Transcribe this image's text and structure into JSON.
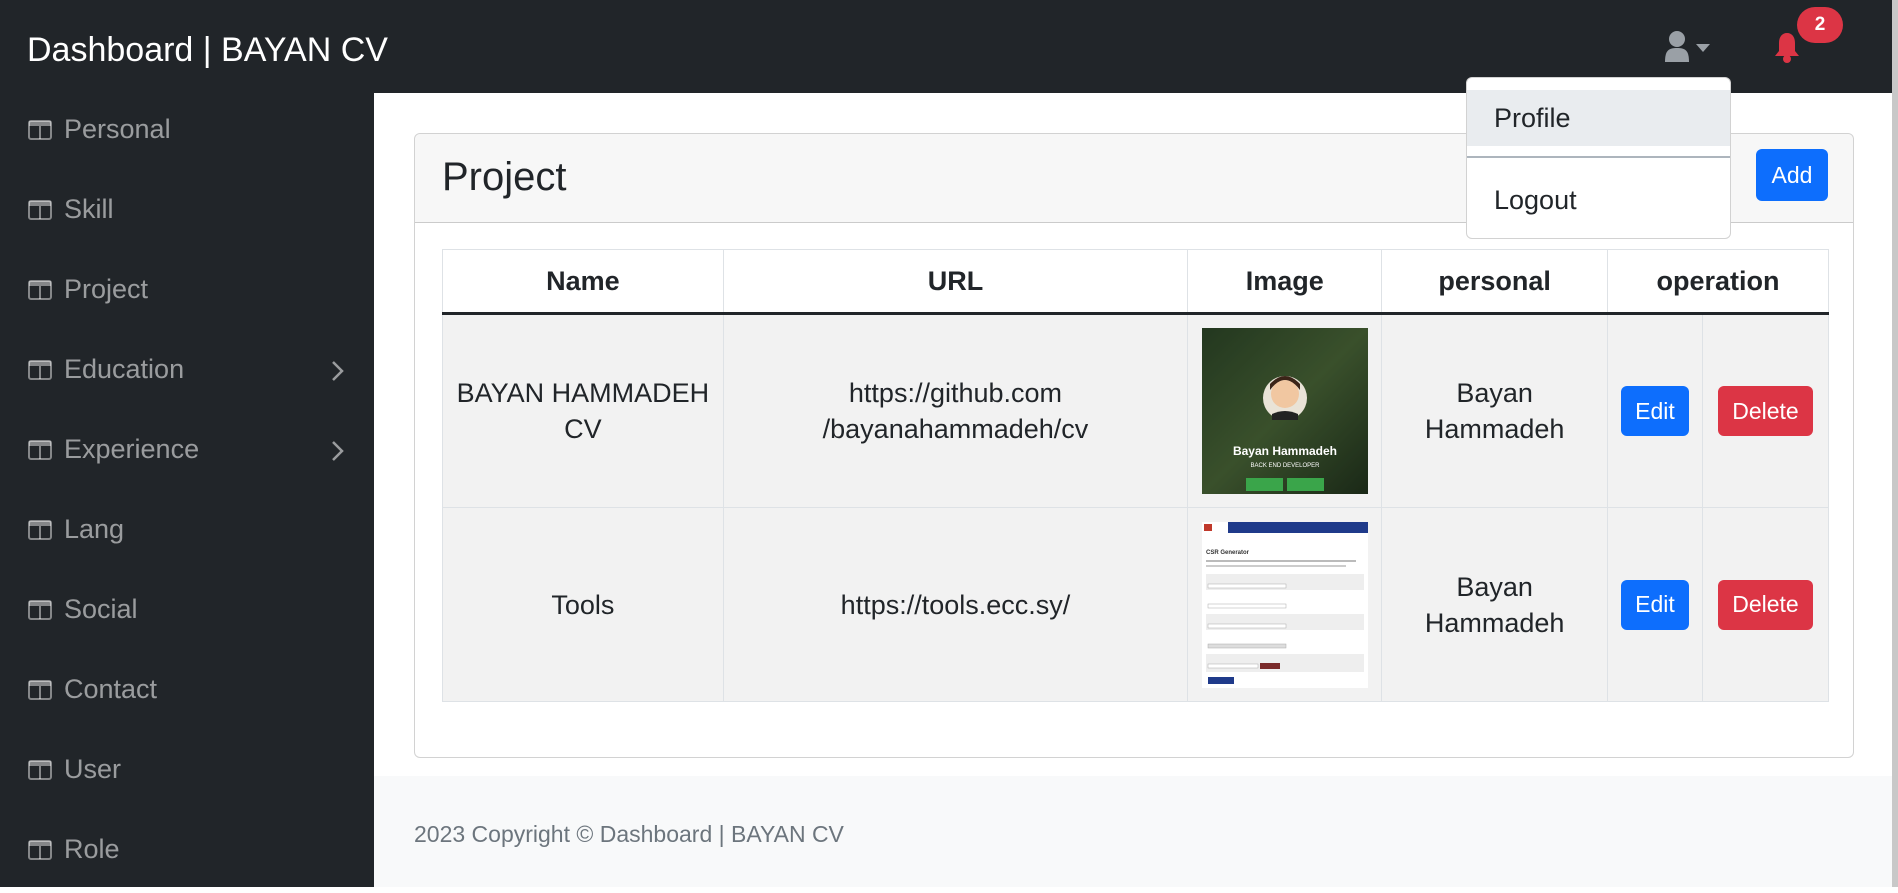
{
  "header": {
    "brand": "Dashboard | BAYAN CV",
    "notification_count": "2"
  },
  "user_dropdown": {
    "items": [
      {
        "label": "Profile",
        "active": true
      },
      {
        "label": "Logout",
        "active": false
      }
    ]
  },
  "sidebar": {
    "items": [
      {
        "label": "Personal",
        "has_submenu": false
      },
      {
        "label": "Skill",
        "has_submenu": false
      },
      {
        "label": "Project",
        "has_submenu": false
      },
      {
        "label": "Education",
        "has_submenu": true
      },
      {
        "label": "Experience",
        "has_submenu": true
      },
      {
        "label": "Lang",
        "has_submenu": false
      },
      {
        "label": "Social",
        "has_submenu": false
      },
      {
        "label": "Contact",
        "has_submenu": false
      },
      {
        "label": "User",
        "has_submenu": false
      },
      {
        "label": "Role",
        "has_submenu": false
      }
    ]
  },
  "page": {
    "title": "Project",
    "add_label": "Add"
  },
  "table": {
    "columns": [
      "Name",
      "URL",
      "Image",
      "personal",
      "operation"
    ],
    "rows": [
      {
        "name": "BAYAN HAMMADEH CV",
        "url": "https://github.com/bayanahammadeh/cv",
        "personal": "Bayan Hammadeh",
        "image": {
          "name": "Bayan Hammadeh",
          "subtitle": "BACK END DEVELOPER"
        },
        "edit_label": "Edit",
        "delete_label": "Delete"
      },
      {
        "name": "Tools",
        "url": "https://tools.ecc.sy/",
        "personal": "Bayan Hammadeh",
        "image": {
          "name": "CSR Generator"
        },
        "edit_label": "Edit",
        "delete_label": "Delete"
      }
    ]
  },
  "footer": {
    "text": "2023 Copyright © Dashboard | BAYAN CV"
  },
  "colors": {
    "dark": "#212529",
    "primary": "#0d6efd",
    "danger": "#dc3545",
    "bell": "#dc3545"
  }
}
